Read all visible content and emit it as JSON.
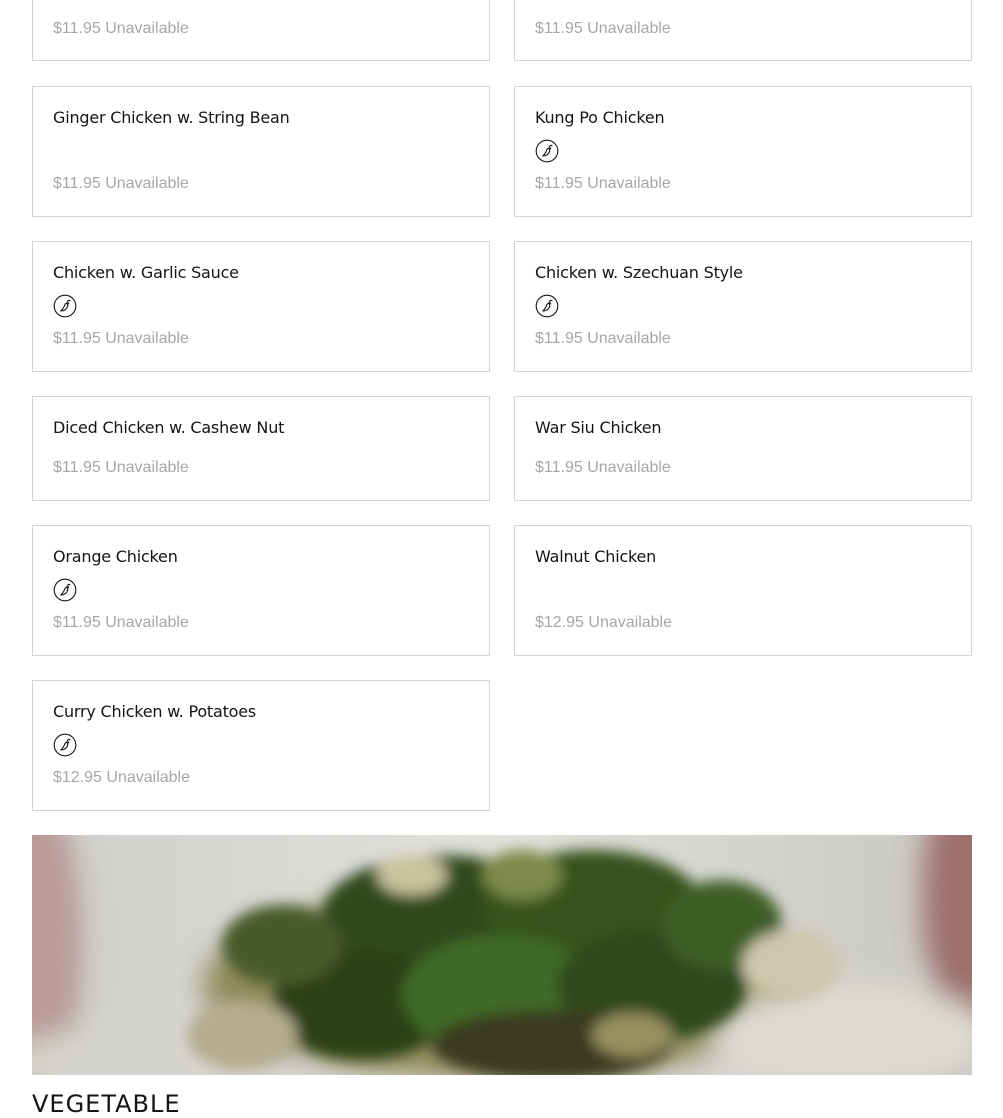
{
  "menu_items": [
    {
      "name": "",
      "price": "$11.95",
      "status": "Unavailable",
      "spicy": false
    },
    {
      "name": "",
      "price": "$11.95",
      "status": "Unavailable",
      "spicy": false
    },
    {
      "name": "Ginger Chicken w. String Bean",
      "price": "$11.95",
      "status": "Unavailable",
      "spicy": false
    },
    {
      "name": "Kung Po Chicken",
      "price": "$11.95",
      "status": "Unavailable",
      "spicy": true
    },
    {
      "name": "Chicken w. Garlic Sauce",
      "price": "$11.95",
      "status": "Unavailable",
      "spicy": true
    },
    {
      "name": "Chicken w. Szechuan Style",
      "price": "$11.95",
      "status": "Unavailable",
      "spicy": true
    },
    {
      "name": "Diced Chicken w. Cashew Nut",
      "price": "$11.95",
      "status": "Unavailable",
      "spicy": false
    },
    {
      "name": "War Siu Chicken",
      "price": "$11.95",
      "status": "Unavailable",
      "spicy": false
    },
    {
      "name": "Orange Chicken",
      "price": "$11.95",
      "status": "Unavailable",
      "spicy": true
    },
    {
      "name": "Walnut Chicken",
      "price": "$12.95",
      "status": "Unavailable",
      "spicy": false
    },
    {
      "name": "Curry Chicken w. Potatoes",
      "price": "$12.95",
      "status": "Unavailable",
      "spicy": true
    }
  ],
  "spicy_icon": "chili-pepper-icon",
  "section_heading": "VEGETABLE",
  "colors": {
    "border": "#d4d4d4",
    "item_name": "#141414",
    "price_text": "#a6a6a6"
  }
}
